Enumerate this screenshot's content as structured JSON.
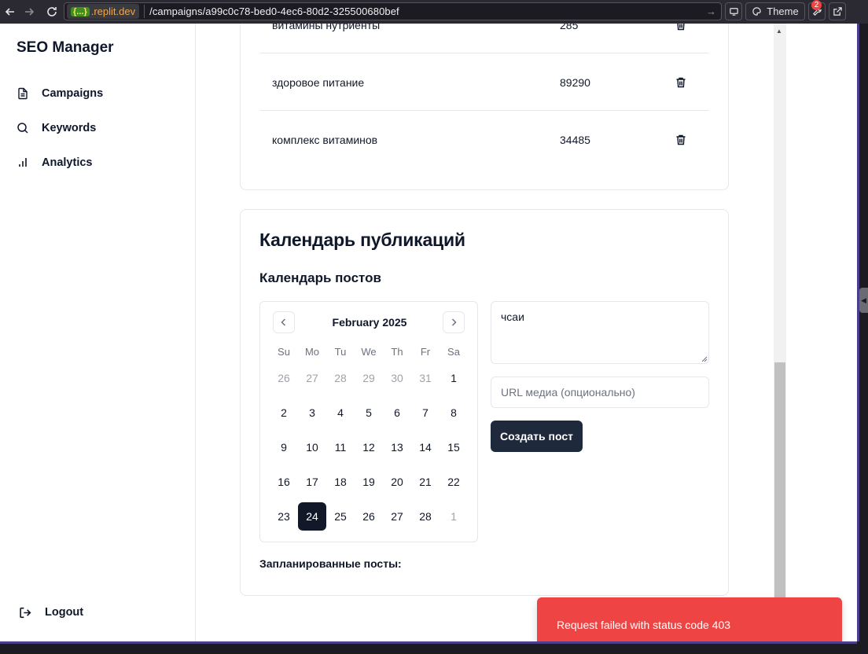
{
  "browser": {
    "url_host_badge": "{...}",
    "url_host": ".replit.dev",
    "url_path": "/campaigns/a99c0c78-bed0-4ec6-80d2-325500680bef",
    "theme_label": "Theme",
    "notification_count": "2"
  },
  "sidebar": {
    "brand": "SEO Manager",
    "items": [
      {
        "label": "Campaigns",
        "icon": "document-icon"
      },
      {
        "label": "Keywords",
        "icon": "search-icon"
      },
      {
        "label": "Analytics",
        "icon": "bar-chart-icon"
      }
    ],
    "logout_label": "Logout"
  },
  "keywords": {
    "rows": [
      {
        "name": "витамины нутриенты",
        "volume": "285"
      },
      {
        "name": "здоровое питание",
        "volume": "89290"
      },
      {
        "name": "комплекс витаминов",
        "volume": "34485"
      }
    ]
  },
  "calendar_section": {
    "title": "Календарь публикаций",
    "subtitle": "Календарь постов",
    "month_label": "February 2025",
    "weekdays": [
      "Su",
      "Mo",
      "Tu",
      "We",
      "Th",
      "Fr",
      "Sa"
    ],
    "weeks": [
      [
        "26",
        "27",
        "28",
        "29",
        "30",
        "31",
        "1"
      ],
      [
        "2",
        "3",
        "4",
        "5",
        "6",
        "7",
        "8"
      ],
      [
        "9",
        "10",
        "11",
        "12",
        "13",
        "14",
        "15"
      ],
      [
        "16",
        "17",
        "18",
        "19",
        "20",
        "21",
        "22"
      ],
      [
        "23",
        "24",
        "25",
        "26",
        "27",
        "28",
        "1"
      ]
    ],
    "selected_day": "24",
    "post_text_value": "чсаи",
    "media_placeholder": "URL медиа (опционально)",
    "create_button_label": "Создать пост",
    "scheduled_label": "Запланированные посты:"
  },
  "toast": {
    "message": "Request failed with status code 403",
    "color": "#ef4444"
  },
  "colors": {
    "primary_button": "#1e293b",
    "selected_day": "#111827",
    "border": "#e5e7eb"
  }
}
